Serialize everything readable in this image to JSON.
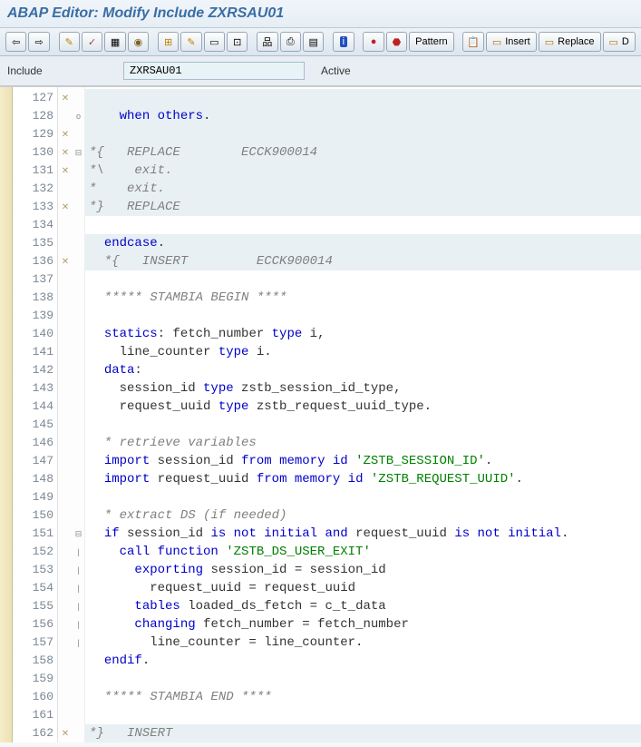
{
  "title": "ABAP Editor: Modify Include ZXRSAU01",
  "toolbar": {
    "pattern": "Pattern",
    "insert": "Insert",
    "replace": "Replace",
    "d": "D"
  },
  "info": {
    "label": "Include",
    "value": "ZXRSAU01",
    "status": "Active"
  },
  "lines": [
    {
      "n": 127,
      "mk": "x",
      "fd": "",
      "hl": 1,
      "seg": []
    },
    {
      "n": 128,
      "mk": "",
      "fd": "o",
      "hl": 1,
      "seg": [
        {
          "t": "    ",
          "c": ""
        },
        {
          "t": "when others",
          "c": "kw"
        },
        {
          "t": ".",
          "c": "op"
        }
      ]
    },
    {
      "n": 129,
      "mk": "x",
      "fd": "",
      "hl": 1,
      "seg": []
    },
    {
      "n": 130,
      "mk": "x",
      "fd": "⊟",
      "hl": 1,
      "seg": [
        {
          "t": "*{   REPLACE        ECCK900014",
          "c": "cm"
        }
      ]
    },
    {
      "n": 131,
      "mk": "x",
      "fd": "",
      "hl": 1,
      "seg": [
        {
          "t": "*\\    exit.",
          "c": "cm"
        }
      ]
    },
    {
      "n": 132,
      "mk": "",
      "fd": "",
      "hl": 1,
      "seg": [
        {
          "t": "*    exit.",
          "c": "cm"
        }
      ]
    },
    {
      "n": 133,
      "mk": "x",
      "fd": "",
      "hl": 1,
      "seg": [
        {
          "t": "*}   REPLACE",
          "c": "cm"
        }
      ]
    },
    {
      "n": 134,
      "mk": "",
      "fd": "",
      "hl": 0,
      "seg": []
    },
    {
      "n": 135,
      "mk": "",
      "fd": "",
      "hl": 1,
      "seg": [
        {
          "t": "  ",
          "c": ""
        },
        {
          "t": "endcase",
          "c": "kw"
        },
        {
          "t": ".",
          "c": "op"
        }
      ]
    },
    {
      "n": 136,
      "mk": "x",
      "fd": "",
      "hl": 1,
      "seg": [
        {
          "t": "  *{   INSERT         ECCK900014",
          "c": "cm"
        }
      ]
    },
    {
      "n": 137,
      "mk": "",
      "fd": "",
      "hl": 0,
      "seg": []
    },
    {
      "n": 138,
      "mk": "",
      "fd": "",
      "hl": 0,
      "seg": [
        {
          "t": "  ***** STAMBIA BEGIN ****",
          "c": "cm"
        }
      ]
    },
    {
      "n": 139,
      "mk": "",
      "fd": "",
      "hl": 0,
      "seg": []
    },
    {
      "n": 140,
      "mk": "",
      "fd": "",
      "hl": 0,
      "seg": [
        {
          "t": "  ",
          "c": ""
        },
        {
          "t": "statics",
          "c": "kw"
        },
        {
          "t": ": fetch_number ",
          "c": "op"
        },
        {
          "t": "type",
          "c": "kw"
        },
        {
          "t": " i,",
          "c": "op"
        }
      ]
    },
    {
      "n": 141,
      "mk": "",
      "fd": "",
      "hl": 0,
      "seg": [
        {
          "t": "    line_counter ",
          "c": "op"
        },
        {
          "t": "type",
          "c": "kw"
        },
        {
          "t": " i.",
          "c": "op"
        }
      ]
    },
    {
      "n": 142,
      "mk": "",
      "fd": "",
      "hl": 0,
      "seg": [
        {
          "t": "  ",
          "c": ""
        },
        {
          "t": "data",
          "c": "kw"
        },
        {
          "t": ":",
          "c": "op"
        }
      ]
    },
    {
      "n": 143,
      "mk": "",
      "fd": "",
      "hl": 0,
      "seg": [
        {
          "t": "    session_id ",
          "c": "op"
        },
        {
          "t": "type",
          "c": "kw"
        },
        {
          "t": " zstb_session_id_type,",
          "c": "op"
        }
      ]
    },
    {
      "n": 144,
      "mk": "",
      "fd": "",
      "hl": 0,
      "seg": [
        {
          "t": "    request_uuid ",
          "c": "op"
        },
        {
          "t": "type",
          "c": "kw"
        },
        {
          "t": " zstb_request_uuid_type.",
          "c": "op"
        }
      ]
    },
    {
      "n": 145,
      "mk": "",
      "fd": "",
      "hl": 0,
      "seg": []
    },
    {
      "n": 146,
      "mk": "",
      "fd": "",
      "hl": 0,
      "seg": [
        {
          "t": "  * retrieve variables",
          "c": "cm"
        }
      ]
    },
    {
      "n": 147,
      "mk": "",
      "fd": "",
      "hl": 0,
      "seg": [
        {
          "t": "  ",
          "c": ""
        },
        {
          "t": "import",
          "c": "kw"
        },
        {
          "t": " session_id ",
          "c": "op"
        },
        {
          "t": "from memory id",
          "c": "kw"
        },
        {
          "t": " ",
          "c": ""
        },
        {
          "t": "'ZSTB_SESSION_ID'",
          "c": "st"
        },
        {
          "t": ".",
          "c": "op"
        }
      ]
    },
    {
      "n": 148,
      "mk": "",
      "fd": "",
      "hl": 0,
      "seg": [
        {
          "t": "  ",
          "c": ""
        },
        {
          "t": "import",
          "c": "kw"
        },
        {
          "t": " request_uuid ",
          "c": "op"
        },
        {
          "t": "from memory id",
          "c": "kw"
        },
        {
          "t": " ",
          "c": ""
        },
        {
          "t": "'ZSTB_REQUEST_UUID'",
          "c": "st"
        },
        {
          "t": ".",
          "c": "op"
        }
      ]
    },
    {
      "n": 149,
      "mk": "",
      "fd": "",
      "hl": 0,
      "seg": []
    },
    {
      "n": 150,
      "mk": "",
      "fd": "",
      "hl": 0,
      "seg": [
        {
          "t": "  * extract DS (if needed)",
          "c": "cm"
        }
      ]
    },
    {
      "n": 151,
      "mk": "",
      "fd": "⊟",
      "hl": 0,
      "seg": [
        {
          "t": "  ",
          "c": ""
        },
        {
          "t": "if",
          "c": "kw"
        },
        {
          "t": " session_id ",
          "c": "op"
        },
        {
          "t": "is not initial and",
          "c": "kw"
        },
        {
          "t": " request_uuid ",
          "c": "op"
        },
        {
          "t": "is not initial",
          "c": "kw"
        },
        {
          "t": ".",
          "c": "op"
        }
      ]
    },
    {
      "n": 152,
      "mk": "",
      "fd": "|",
      "hl": 0,
      "seg": [
        {
          "t": "    ",
          "c": ""
        },
        {
          "t": "call function",
          "c": "kw"
        },
        {
          "t": " ",
          "c": ""
        },
        {
          "t": "'ZSTB_DS_USER_EXIT'",
          "c": "st"
        }
      ]
    },
    {
      "n": 153,
      "mk": "",
      "fd": "|",
      "hl": 0,
      "seg": [
        {
          "t": "      ",
          "c": ""
        },
        {
          "t": "exporting",
          "c": "kw"
        },
        {
          "t": " session_id = session_id",
          "c": "op"
        }
      ]
    },
    {
      "n": 154,
      "mk": "",
      "fd": "|",
      "hl": 0,
      "seg": [
        {
          "t": "        request_uuid = request_uuid",
          "c": "op"
        }
      ]
    },
    {
      "n": 155,
      "mk": "",
      "fd": "|",
      "hl": 0,
      "seg": [
        {
          "t": "      ",
          "c": ""
        },
        {
          "t": "tables",
          "c": "kw"
        },
        {
          "t": " loaded_ds_fetch = c_t_data",
          "c": "op"
        }
      ]
    },
    {
      "n": 156,
      "mk": "",
      "fd": "|",
      "hl": 0,
      "seg": [
        {
          "t": "      ",
          "c": ""
        },
        {
          "t": "changing",
          "c": "kw"
        },
        {
          "t": " fetch_number = fetch_number",
          "c": "op"
        }
      ]
    },
    {
      "n": 157,
      "mk": "",
      "fd": "|",
      "hl": 0,
      "seg": [
        {
          "t": "        line_counter = line_counter.",
          "c": "op"
        }
      ]
    },
    {
      "n": 158,
      "mk": "",
      "fd": "",
      "hl": 0,
      "seg": [
        {
          "t": "  ",
          "c": ""
        },
        {
          "t": "endif",
          "c": "kw"
        },
        {
          "t": ".",
          "c": "op"
        }
      ]
    },
    {
      "n": 159,
      "mk": "",
      "fd": "",
      "hl": 0,
      "seg": []
    },
    {
      "n": 160,
      "mk": "",
      "fd": "",
      "hl": 0,
      "seg": [
        {
          "t": "  ***** STAMBIA END ****",
          "c": "cm"
        }
      ]
    },
    {
      "n": 161,
      "mk": "",
      "fd": "",
      "hl": 0,
      "seg": []
    },
    {
      "n": 162,
      "mk": "x",
      "fd": "",
      "hl": 1,
      "seg": [
        {
          "t": "*}   INSERT",
          "c": "cm"
        }
      ]
    }
  ]
}
